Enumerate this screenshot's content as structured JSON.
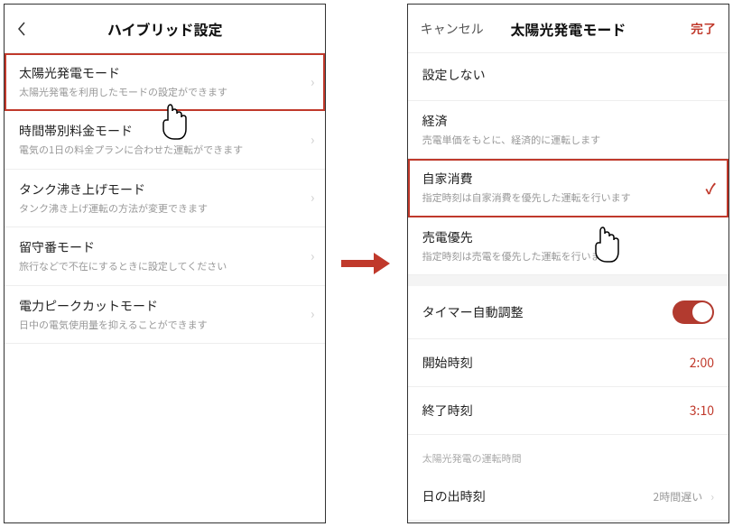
{
  "left_screen": {
    "title": "ハイブリッド設定",
    "items": [
      {
        "title": "太陽光発電モード",
        "sub": "太陽光発電を利用したモードの設定ができます",
        "highlight": true
      },
      {
        "title": "時間帯別料金モード",
        "sub": "電気の1日の料金プランに合わせた運転ができます"
      },
      {
        "title": "タンク沸き上げモード",
        "sub": "タンク沸き上げ運転の方法が変更できます"
      },
      {
        "title": "留守番モード",
        "sub": "旅行などで不在にするときに設定してください"
      },
      {
        "title": "電力ピークカットモード",
        "sub": "日中の電気使用量を抑えることができます"
      }
    ]
  },
  "right_screen": {
    "cancel": "キャンセル",
    "done": "完了",
    "title": "太陽光発電モード",
    "options": [
      {
        "title": "設定しない",
        "sub": ""
      },
      {
        "title": "経済",
        "sub": "売電単価をもとに、経済的に運転します"
      },
      {
        "title": "自家消費",
        "sub": "指定時刻は自家消費を優先した運転を行います",
        "selected": true,
        "highlight": true
      },
      {
        "title": "売電優先",
        "sub": "指定時刻は売電を優先した運転を行います"
      }
    ],
    "timer_auto": {
      "label": "タイマー自動調整"
    },
    "start_time": {
      "label": "開始時刻",
      "value": "2:00"
    },
    "end_time": {
      "label": "終了時刻",
      "value": "3:10"
    },
    "runtime_label": "太陽光発電の運転時間",
    "sunrise": {
      "label": "日の出時刻",
      "value": "2時間遅い"
    }
  }
}
